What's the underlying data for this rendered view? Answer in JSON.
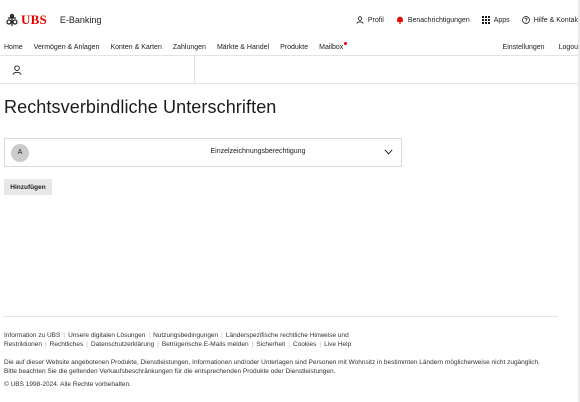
{
  "brand": {
    "name": "UBS",
    "app": "E-Banking"
  },
  "utility": {
    "profil": "Profil",
    "benachrichtigungen": "Benachrichtigungen",
    "apps": "Apps",
    "hilfe": "Hilfe & Kontakt"
  },
  "nav": {
    "items": [
      "Home",
      "Vermögen & Anlagen",
      "Konten & Karten",
      "Zahlungen",
      "Märkte & Handel",
      "Produkte",
      "Mailbox"
    ],
    "right": [
      "Einstellungen",
      "Logout"
    ]
  },
  "page": {
    "title": "Rechtsverbindliche Unterschriften",
    "signer": {
      "avatar": "A",
      "label": "Einzelzeichnungsberechtigung"
    },
    "add_button": "Hinzufügen"
  },
  "footer": {
    "links_line1": [
      "Information zu UBS",
      "Unsere digitalen Lösungen",
      "Nutzungsbedingungen",
      "Länderspezifische rechtliche Hinweise und"
    ],
    "links_line2": [
      "Restriktionen",
      "Rechtliches",
      "Datenschutzerklärung",
      "Betrügerische E-Mails melden",
      "Sicherheit",
      "Cookies",
      "Live Help"
    ],
    "disclaimer1": "Die auf dieser Website angebotenen Produkte, Dienstleistungen, Informationen und/oder Unterlagen sind Personen mit Wohnsitz in bestimmten Ländern möglicherweise nicht zugänglich.",
    "disclaimer2": "Bitte beachten Sie die geltenden Verkaufsbeschränkungen für die entsprechenden Produkte oder Dienstleistungen.",
    "copyright": "© UBS 1998-2024. Alle Rechte vorbehalten."
  },
  "colors": {
    "brand_red": "#e60000",
    "button_bg": "#e7e7e7",
    "avatar_bg": "#cccccc"
  },
  "icons": [
    "ubs-keys-icon",
    "user-icon",
    "bell-icon",
    "grid-icon",
    "help-icon",
    "chevron-down-icon"
  ]
}
